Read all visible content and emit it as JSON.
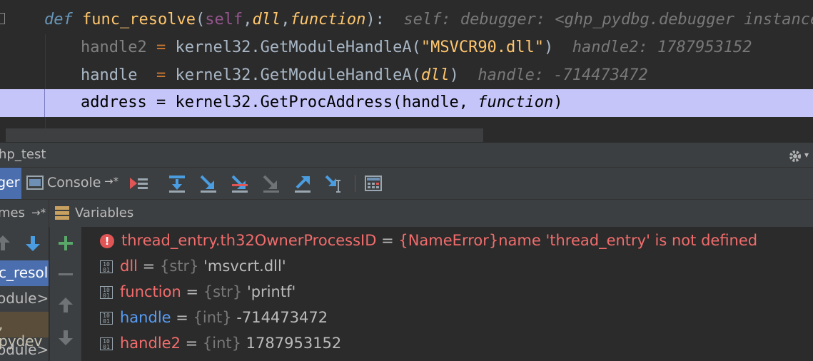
{
  "editor": {
    "line1": {
      "def": "def",
      "name": "func_resolve",
      "open": "(",
      "self": "self",
      "comma1": ",",
      "p1": "dll",
      "comma2": ",",
      "p2": "function",
      "close": "):",
      "hint": "self: debugger: <ghp_pydbg.debugger instance"
    },
    "line2": {
      "var": "handle2",
      "eq": " = ",
      "call": "kernel32.GetModuleHandleA(",
      "arg": "\"MSVCR90.dll\"",
      "close": ")",
      "hint": "handle2: 1787953152"
    },
    "line3": {
      "var": "handle ",
      "eq": " = ",
      "call": "kernel32.GetModuleHandleA(",
      "arg": "dll",
      "close": ")",
      "hint": "handle: -714473472"
    },
    "line4": {
      "text": "address = kernel32.GetProcAddress(handle, ",
      "arg": "function",
      "close": ")"
    }
  },
  "debug": {
    "run_config": "hp_test",
    "tabs": {
      "debugger": "ger",
      "console": "Console",
      "console_arrow": "→*"
    },
    "panes": {
      "frames": "mes",
      "frames_arrow": "→*",
      "variables": "Variables"
    },
    "frames": [
      "c_resol",
      "odule>",
      ", pydev",
      "odule>"
    ],
    "variables": [
      {
        "kind": "error",
        "name": "thread_entry.th32OwnerProcessID",
        "eq": " = ",
        "type": "{NameError}",
        "value": "name 'thread_entry' is not defined"
      },
      {
        "kind": "var",
        "name": "dll",
        "eq": " = ",
        "type": "{str}",
        "value": " 'msvcrt.dll'"
      },
      {
        "kind": "var",
        "name": "function",
        "eq": " = ",
        "type": "{str}",
        "value": " 'printf'"
      },
      {
        "kind": "var",
        "name": "handle",
        "eq": " = ",
        "type": "{int}",
        "value": " -714473472"
      },
      {
        "kind": "var",
        "name": "handle2",
        "eq": " = ",
        "type": "{int}",
        "value": " 1787953152"
      }
    ],
    "icons": [
      "settings-gear-icon",
      "console-icon",
      "show-execution-point-icon",
      "step-over-icon",
      "step-into-icon",
      "step-into-my-code-icon",
      "force-step-into-icon",
      "step-out-icon",
      "run-to-cursor-icon",
      "evaluate-expression-icon",
      "variables-icon",
      "add-watch-icon",
      "remove-watch-icon",
      "move-up-icon",
      "move-down-icon",
      "frame-up-icon",
      "frame-down-icon",
      "error-icon",
      "binary-value-icon"
    ],
    "binary_icon_text": "10\n01"
  }
}
